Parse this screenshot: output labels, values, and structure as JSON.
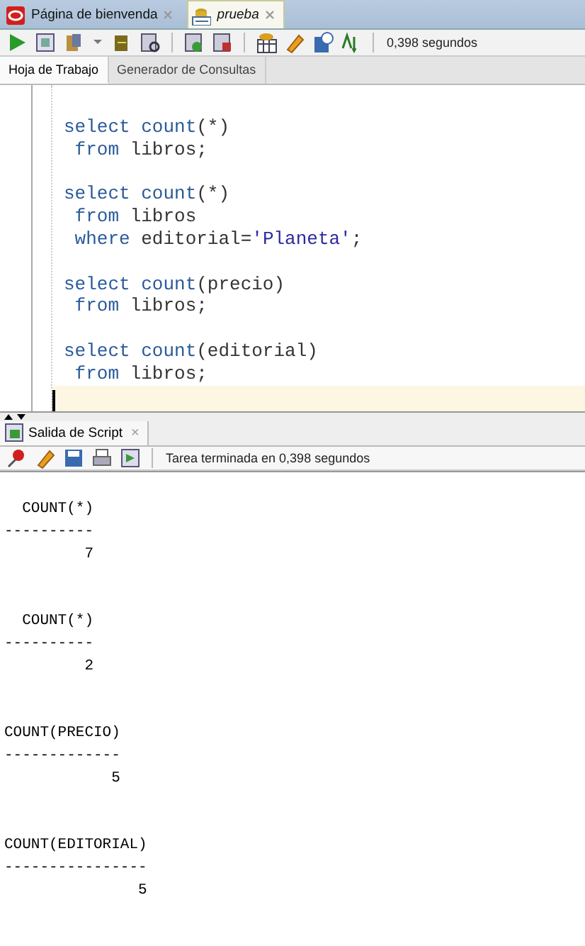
{
  "doc_tabs": [
    {
      "label": "Página de bienvenda",
      "kind": "welcome",
      "selected": false
    },
    {
      "label": "prueba",
      "kind": "sql",
      "selected": true
    }
  ],
  "toolbar": {
    "elapsed": "0,398 segundos"
  },
  "sub_tabs": [
    {
      "label": "Hoja de Trabajo",
      "selected": true
    },
    {
      "label": "Generador de Consultas",
      "selected": false
    }
  ],
  "editor": {
    "statements": [
      [
        [
          {
            "kind": "keyword",
            "text": "select"
          },
          {
            "kind": "keyword",
            "text": " count"
          },
          {
            "kind": "plain",
            "text": "(*)"
          }
        ],
        [
          {
            "kind": "keyword",
            "text": " from"
          },
          {
            "kind": "plain",
            "text": " libros;"
          }
        ]
      ],
      [
        [
          {
            "kind": "keyword",
            "text": "select"
          },
          {
            "kind": "keyword",
            "text": " count"
          },
          {
            "kind": "plain",
            "text": "(*)"
          }
        ],
        [
          {
            "kind": "keyword",
            "text": " from"
          },
          {
            "kind": "plain",
            "text": " libros"
          }
        ],
        [
          {
            "kind": "keyword",
            "text": " where"
          },
          {
            "kind": "plain",
            "text": " editorial="
          },
          {
            "kind": "string",
            "text": "'Planeta'"
          },
          {
            "kind": "plain",
            "text": ";"
          }
        ]
      ],
      [
        [
          {
            "kind": "keyword",
            "text": "select"
          },
          {
            "kind": "keyword",
            "text": " count"
          },
          {
            "kind": "plain",
            "text": "(precio)"
          }
        ],
        [
          {
            "kind": "keyword",
            "text": " from"
          },
          {
            "kind": "plain",
            "text": " libros;"
          }
        ]
      ],
      [
        [
          {
            "kind": "keyword",
            "text": "select"
          },
          {
            "kind": "keyword",
            "text": " count"
          },
          {
            "kind": "plain",
            "text": "(editorial)"
          }
        ],
        [
          {
            "kind": "keyword",
            "text": " from"
          },
          {
            "kind": "plain",
            "text": " libros;"
          }
        ]
      ]
    ]
  },
  "output_tab": {
    "label": "Salida de Script",
    "close": "×"
  },
  "output_toolbar": {
    "status": "Tarea terminada en 0,398 segundos"
  },
  "results": [
    {
      "header": "  COUNT(*)",
      "rule": "----------",
      "value": "         7"
    },
    {
      "header": "  COUNT(*)",
      "rule": "----------",
      "value": "         2"
    },
    {
      "header": "COUNT(PRECIO)",
      "rule": "-------------",
      "value": "            5"
    },
    {
      "header": "COUNT(EDITORIAL)",
      "rule": "----------------",
      "value": "               5"
    }
  ]
}
